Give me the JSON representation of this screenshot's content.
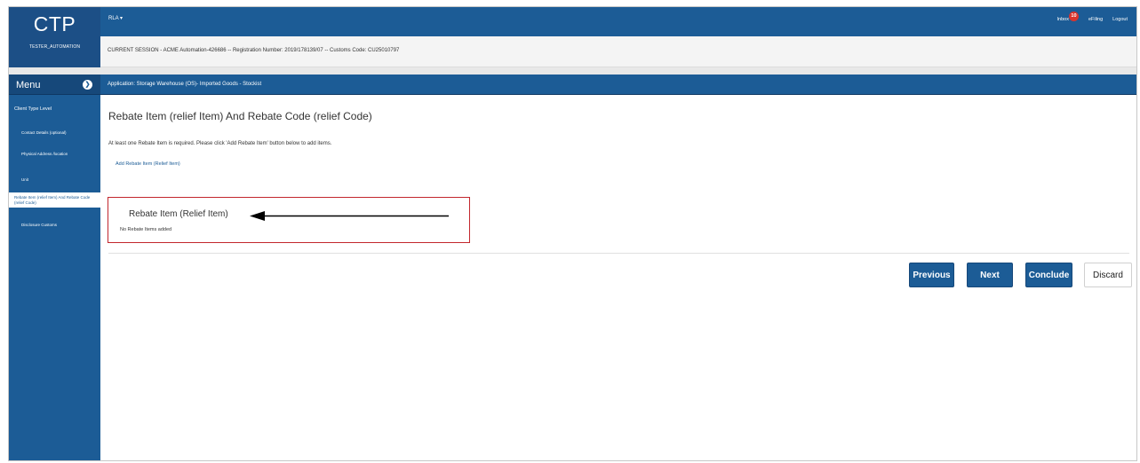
{
  "logo": {
    "brand": "CTP",
    "user": "TESTER_AUTOMATION"
  },
  "topbar": {
    "app_dropdown": "RLA ▾",
    "inbox_label": "Inbox",
    "inbox_count": "10",
    "efiling_label": "eFiling",
    "logout_label": "Logout"
  },
  "session": {
    "text": "CURRENT SESSION - ACME Automation-426686 -- Registration Number: 2019/178139/07 -- Customs Code: CU25010797"
  },
  "sidebar": {
    "menu_title": "Menu",
    "menu_toggle": "❯",
    "level_label": "Client Type Level",
    "items": [
      {
        "label": "Contact Details (optional)"
      },
      {
        "label": "Physical Address /location"
      },
      {
        "label": "Unit"
      },
      {
        "label": "Rebate Item (relief Item) And Rebate Code (relief Code)"
      },
      {
        "label": "Disclosure Customs"
      }
    ]
  },
  "appbar": {
    "text": "Application: Storage Warehouse (OS)- Imported Goods - Stockist"
  },
  "main": {
    "title": "Rebate Item (relief Item) And Rebate Code (relief Code)",
    "info": "At least one Rebate Item is required. Please click 'Add Rebate Item' button below to add items.",
    "add_link": "Add Rebate Item (Relief Item)",
    "box_title": "Rebate Item (Relief Item)",
    "box_empty": "No Rebate Items added"
  },
  "buttons": {
    "previous": "Previous",
    "next": "Next",
    "conclude": "Conclude",
    "discard": "Discard"
  },
  "colors": {
    "primary": "#1c5c96",
    "primary_dark": "#16487a",
    "highlight_border": "#c2272d",
    "badge": "#d8342d"
  },
  "icons": {
    "menu_toggle": "chevron-right-icon",
    "annotation": "arrow-left-icon",
    "dropdown": "caret-down-icon"
  }
}
